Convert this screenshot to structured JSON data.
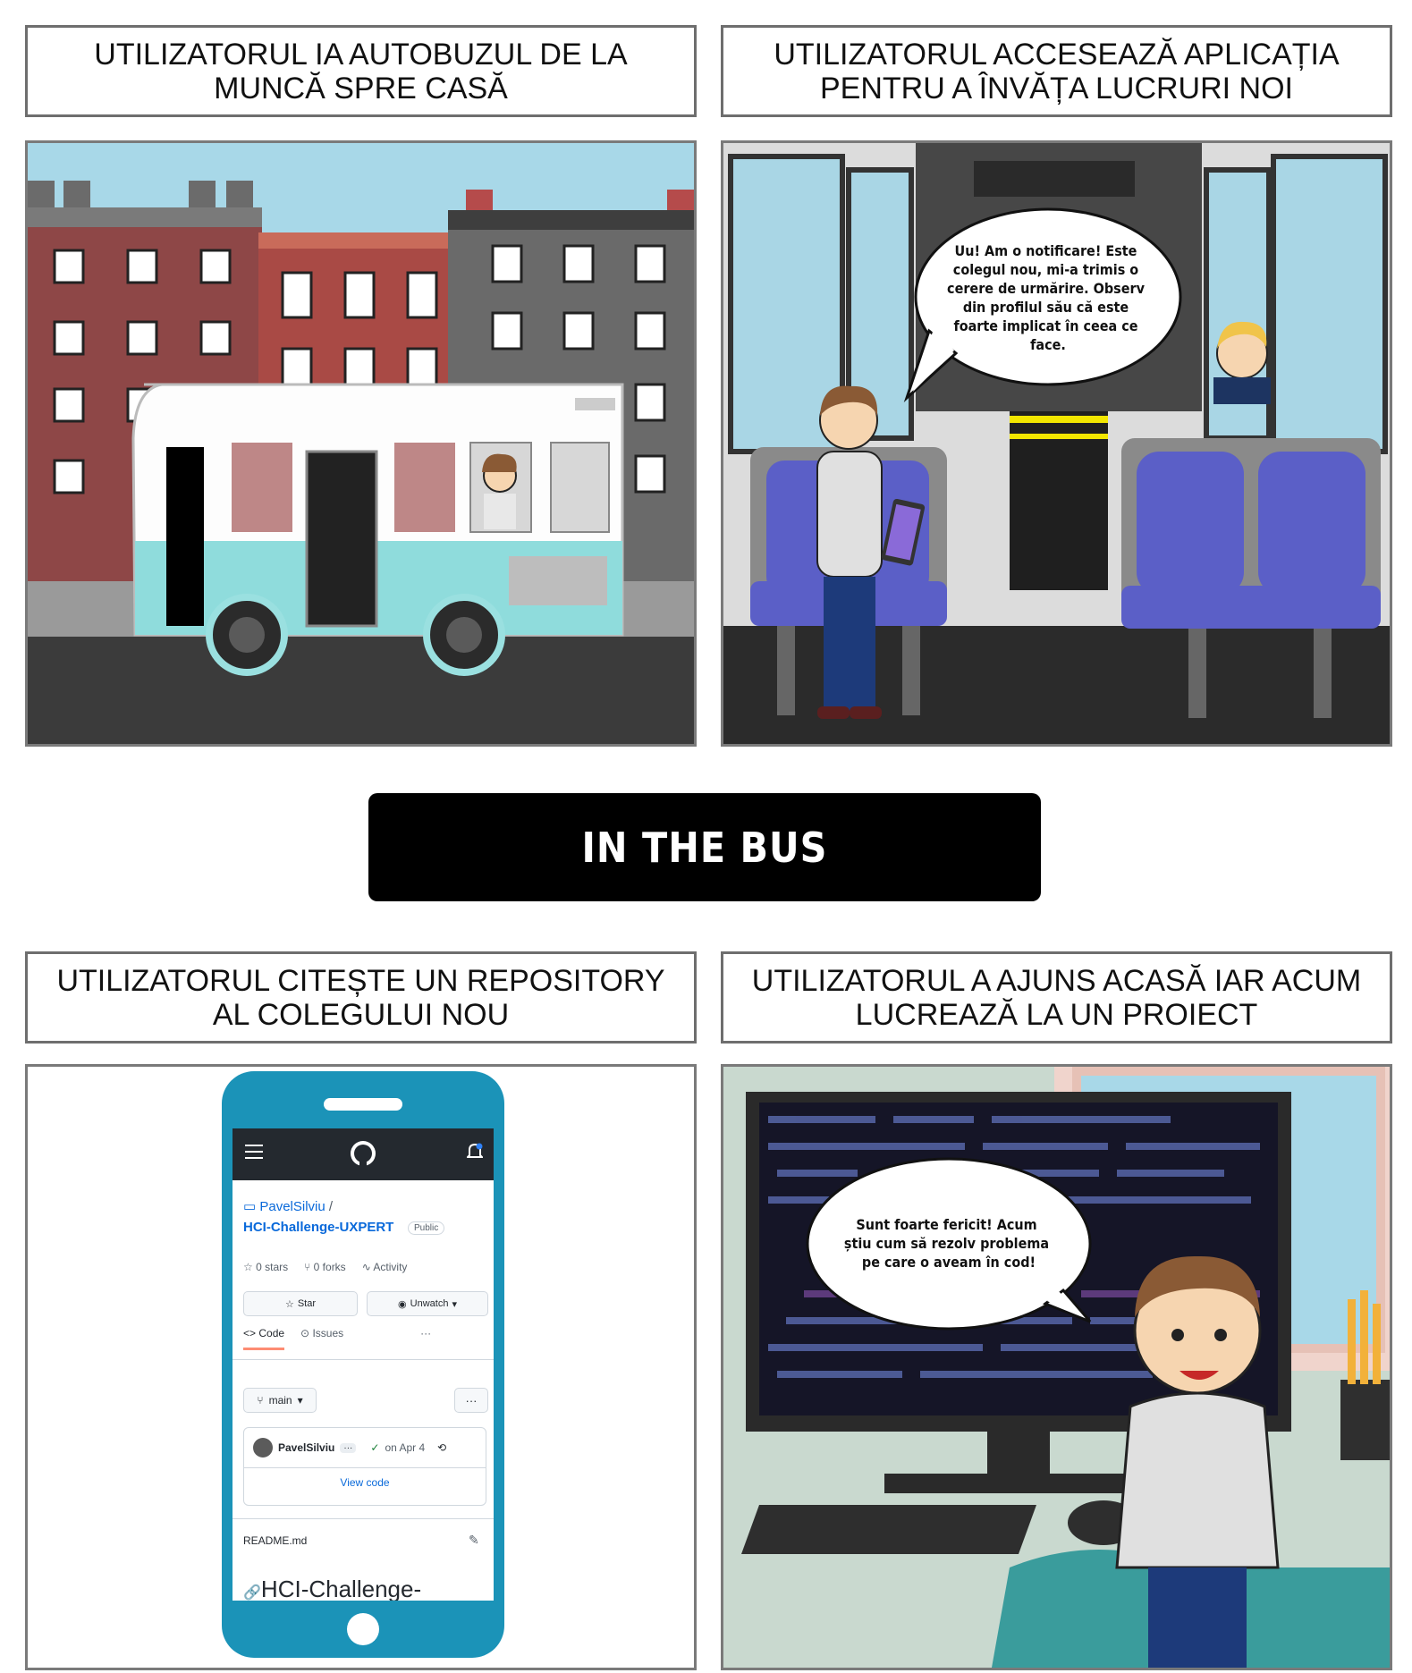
{
  "panels": [
    {
      "caption": "UTILIZATORUL IA AUTOBUZUL DE LA MUNCĂ SPRE CASĂ"
    },
    {
      "caption": "UTILIZATORUL ACCESEAZĂ APLICAȚIA PENTRU A ÎNVĂȚA LUCRURI NOI",
      "bubble_lines": [
        "Uu! Am o notificare! Este",
        "colegul nou, mi-a trimis o",
        "cerere de urmărire. Observ",
        "din profilul său că este",
        "foarte implicat în ceea ce",
        "face."
      ]
    },
    {
      "caption": "UTILIZATORUL CITEȘTE UN REPOSITORY AL COLEGULUI NOU"
    },
    {
      "caption": "UTILIZATORUL A AJUNS ACASĂ IAR ACUM LUCREAZĂ LA UN PROIECT",
      "bubble_lines": [
        "Sunt foarte fericit! Acum",
        "știu cum să rezolv problema",
        "pe care o aveam în cod!"
      ]
    }
  ],
  "banner": "IN THE BUS",
  "phone": {
    "owner": "PavelSilviu",
    "slash": "/",
    "repo": "HCI-Challenge-UXPERT",
    "visibility": "Public",
    "stars": "0 stars",
    "forks": "0 forks",
    "activity": "Activity",
    "star_btn": "Star",
    "unwatch_btn": "Unwatch",
    "tab_code": "Code",
    "tab_issues": "Issues",
    "more": "···",
    "branch": "main",
    "commit_author": "PavelSilviu",
    "commit_dots": "···",
    "commit_date": "on Apr 4",
    "view_code": "View code",
    "readme_file": "README.md",
    "readme_title": "HCI-Challenge-"
  },
  "colors": {
    "phone_body": "#1b93b8",
    "github_bar": "#24292f",
    "link": "#0969da",
    "bus_body": "#8fdcdc",
    "seat": "#5b5fc7"
  }
}
